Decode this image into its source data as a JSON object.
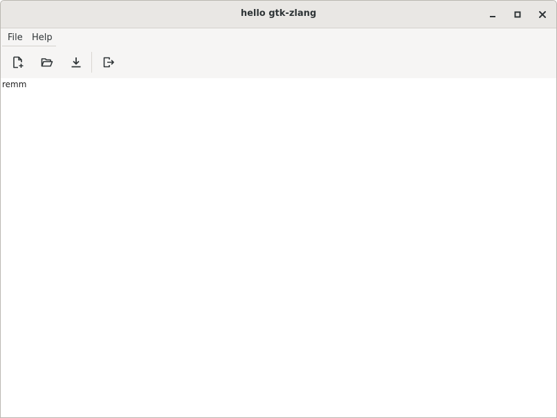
{
  "window": {
    "title": "hello gtk-zlang",
    "controls": {
      "minimize_icon": "minimize-icon",
      "maximize_icon": "maximize-icon",
      "close_icon": "close-icon"
    }
  },
  "menubar": {
    "items": [
      {
        "label": "File"
      },
      {
        "label": "Help"
      }
    ]
  },
  "toolbar": {
    "buttons": [
      {
        "icon": "new-document-icon"
      },
      {
        "icon": "open-folder-icon"
      },
      {
        "icon": "download-save-icon"
      },
      {
        "icon": "quit-exit-icon"
      }
    ]
  },
  "content": {
    "text": "remm"
  },
  "colors": {
    "titlebar": "#e9e7e4",
    "toolbar": "#f6f5f4",
    "text": "#2e3436"
  }
}
